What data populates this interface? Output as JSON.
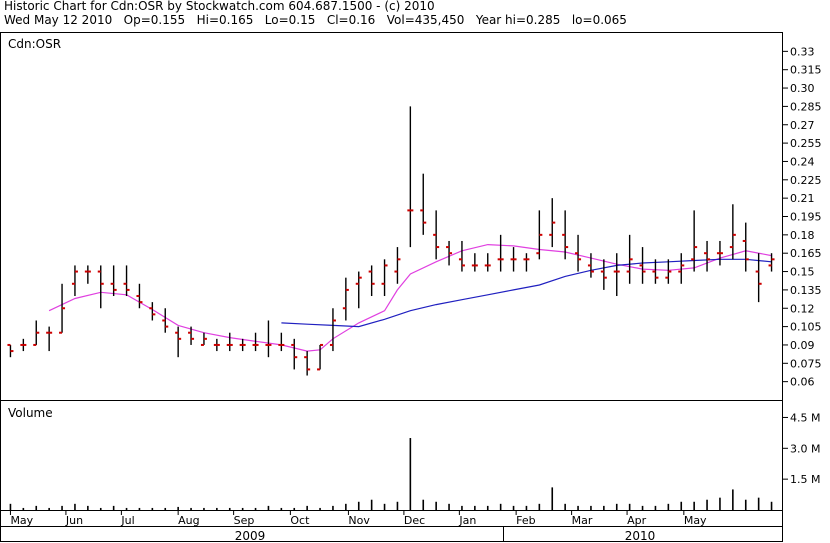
{
  "header": {
    "line1": "Historic Chart for Cdn:OSR by Stockwatch.com 604.687.1500 - (c) 2010",
    "line2": "Wed May 12 2010   Op=0.155   Hi=0.165   Lo=0.15   Cl=0.16   Vol=435,450   Year hi=0.285   lo=0.065"
  },
  "chart_data": {
    "type": "bar",
    "title": "Cdn:OSR",
    "price_panel": {
      "ylim": [
        0.045,
        0.345
      ],
      "yticks": [
        "0.33",
        "0.315",
        "0.30",
        "0.285",
        "0.27",
        "0.255",
        "0.24",
        "0.225",
        "0.21",
        "0.195",
        "0.18",
        "0.165",
        "0.15",
        "0.135",
        "0.12",
        "0.105",
        "0.09",
        "0.075",
        "0.06"
      ],
      "ohlc_weekly": [
        {
          "w": 0,
          "o": 0.09,
          "h": 0.09,
          "l": 0.08,
          "c": 0.085
        },
        {
          "w": 1,
          "o": 0.09,
          "h": 0.095,
          "l": 0.085,
          "c": 0.09
        },
        {
          "w": 2,
          "o": 0.09,
          "h": 0.11,
          "l": 0.09,
          "c": 0.1
        },
        {
          "w": 3,
          "o": 0.1,
          "h": 0.105,
          "l": 0.085,
          "c": 0.1
        },
        {
          "w": 4,
          "o": 0.1,
          "h": 0.14,
          "l": 0.1,
          "c": 0.12
        },
        {
          "w": 5,
          "o": 0.14,
          "h": 0.155,
          "l": 0.13,
          "c": 0.15
        },
        {
          "w": 6,
          "o": 0.15,
          "h": 0.155,
          "l": 0.14,
          "c": 0.15
        },
        {
          "w": 7,
          "o": 0.15,
          "h": 0.155,
          "l": 0.12,
          "c": 0.14
        },
        {
          "w": 8,
          "o": 0.14,
          "h": 0.155,
          "l": 0.13,
          "c": 0.135
        },
        {
          "w": 9,
          "o": 0.14,
          "h": 0.155,
          "l": 0.13,
          "c": 0.135
        },
        {
          "w": 10,
          "o": 0.13,
          "h": 0.14,
          "l": 0.12,
          "c": 0.125
        },
        {
          "w": 11,
          "o": 0.12,
          "h": 0.125,
          "l": 0.11,
          "c": 0.115
        },
        {
          "w": 12,
          "o": 0.11,
          "h": 0.12,
          "l": 0.1,
          "c": 0.105
        },
        {
          "w": 13,
          "o": 0.1,
          "h": 0.105,
          "l": 0.08,
          "c": 0.095
        },
        {
          "w": 14,
          "o": 0.1,
          "h": 0.105,
          "l": 0.09,
          "c": 0.095
        },
        {
          "w": 15,
          "o": 0.09,
          "h": 0.1,
          "l": 0.09,
          "c": 0.095
        },
        {
          "w": 16,
          "o": 0.09,
          "h": 0.095,
          "l": 0.085,
          "c": 0.09
        },
        {
          "w": 17,
          "o": 0.09,
          "h": 0.1,
          "l": 0.085,
          "c": 0.09
        },
        {
          "w": 18,
          "o": 0.09,
          "h": 0.095,
          "l": 0.085,
          "c": 0.09
        },
        {
          "w": 19,
          "o": 0.09,
          "h": 0.1,
          "l": 0.085,
          "c": 0.09
        },
        {
          "w": 20,
          "o": 0.09,
          "h": 0.11,
          "l": 0.08,
          "c": 0.09
        },
        {
          "w": 21,
          "o": 0.09,
          "h": 0.1,
          "l": 0.085,
          "c": 0.09
        },
        {
          "w": 22,
          "o": 0.09,
          "h": 0.095,
          "l": 0.07,
          "c": 0.08
        },
        {
          "w": 23,
          "o": 0.08,
          "h": 0.085,
          "l": 0.065,
          "c": 0.07
        },
        {
          "w": 24,
          "o": 0.07,
          "h": 0.09,
          "l": 0.07,
          "c": 0.09
        },
        {
          "w": 25,
          "o": 0.09,
          "h": 0.12,
          "l": 0.085,
          "c": 0.11
        },
        {
          "w": 26,
          "o": 0.12,
          "h": 0.145,
          "l": 0.11,
          "c": 0.135
        },
        {
          "w": 27,
          "o": 0.14,
          "h": 0.15,
          "l": 0.12,
          "c": 0.145
        },
        {
          "w": 28,
          "o": 0.15,
          "h": 0.155,
          "l": 0.13,
          "c": 0.14
        },
        {
          "w": 29,
          "o": 0.14,
          "h": 0.16,
          "l": 0.13,
          "c": 0.155
        },
        {
          "w": 30,
          "o": 0.15,
          "h": 0.17,
          "l": 0.14,
          "c": 0.16
        },
        {
          "w": 31,
          "o": 0.2,
          "h": 0.285,
          "l": 0.17,
          "c": 0.2
        },
        {
          "w": 32,
          "o": 0.2,
          "h": 0.23,
          "l": 0.18,
          "c": 0.19
        },
        {
          "w": 33,
          "o": 0.18,
          "h": 0.2,
          "l": 0.16,
          "c": 0.17
        },
        {
          "w": 34,
          "o": 0.17,
          "h": 0.175,
          "l": 0.155,
          "c": 0.165
        },
        {
          "w": 35,
          "o": 0.16,
          "h": 0.175,
          "l": 0.15,
          "c": 0.155
        },
        {
          "w": 36,
          "o": 0.155,
          "h": 0.165,
          "l": 0.15,
          "c": 0.155
        },
        {
          "w": 37,
          "o": 0.155,
          "h": 0.165,
          "l": 0.15,
          "c": 0.155
        },
        {
          "w": 38,
          "o": 0.16,
          "h": 0.18,
          "l": 0.15,
          "c": 0.16
        },
        {
          "w": 39,
          "o": 0.16,
          "h": 0.17,
          "l": 0.15,
          "c": 0.16
        },
        {
          "w": 40,
          "o": 0.16,
          "h": 0.165,
          "l": 0.15,
          "c": 0.16
        },
        {
          "w": 41,
          "o": 0.165,
          "h": 0.2,
          "l": 0.16,
          "c": 0.18
        },
        {
          "w": 42,
          "o": 0.18,
          "h": 0.21,
          "l": 0.17,
          "c": 0.19
        },
        {
          "w": 43,
          "o": 0.18,
          "h": 0.2,
          "l": 0.16,
          "c": 0.17
        },
        {
          "w": 44,
          "o": 0.165,
          "h": 0.18,
          "l": 0.15,
          "c": 0.16
        },
        {
          "w": 45,
          "o": 0.155,
          "h": 0.165,
          "l": 0.145,
          "c": 0.15
        },
        {
          "w": 46,
          "o": 0.15,
          "h": 0.16,
          "l": 0.135,
          "c": 0.145
        },
        {
          "w": 47,
          "o": 0.15,
          "h": 0.165,
          "l": 0.13,
          "c": 0.15
        },
        {
          "w": 48,
          "o": 0.15,
          "h": 0.18,
          "l": 0.14,
          "c": 0.16
        },
        {
          "w": 49,
          "o": 0.155,
          "h": 0.17,
          "l": 0.14,
          "c": 0.15
        },
        {
          "w": 50,
          "o": 0.15,
          "h": 0.16,
          "l": 0.14,
          "c": 0.145
        },
        {
          "w": 51,
          "o": 0.145,
          "h": 0.16,
          "l": 0.14,
          "c": 0.15
        },
        {
          "w": 52,
          "o": 0.15,
          "h": 0.165,
          "l": 0.14,
          "c": 0.155
        },
        {
          "w": 53,
          "o": 0.16,
          "h": 0.2,
          "l": 0.15,
          "c": 0.17
        },
        {
          "w": 54,
          "o": 0.165,
          "h": 0.175,
          "l": 0.15,
          "c": 0.16
        },
        {
          "w": 55,
          "o": 0.165,
          "h": 0.175,
          "l": 0.155,
          "c": 0.165
        },
        {
          "w": 56,
          "o": 0.17,
          "h": 0.205,
          "l": 0.16,
          "c": 0.18
        },
        {
          "w": 57,
          "o": 0.175,
          "h": 0.19,
          "l": 0.15,
          "c": 0.16
        },
        {
          "w": 58,
          "o": 0.15,
          "h": 0.165,
          "l": 0.125,
          "c": 0.14
        },
        {
          "w": 59,
          "o": 0.155,
          "h": 0.165,
          "l": 0.15,
          "c": 0.16
        }
      ],
      "ma_pink": [
        [
          3,
          0.118
        ],
        [
          5,
          0.128
        ],
        [
          7,
          0.133
        ],
        [
          9,
          0.131
        ],
        [
          11,
          0.119
        ],
        [
          13,
          0.106
        ],
        [
          15,
          0.1
        ],
        [
          17,
          0.096
        ],
        [
          19,
          0.093
        ],
        [
          21,
          0.09
        ],
        [
          23,
          0.085
        ],
        [
          24,
          0.086
        ],
        [
          25,
          0.095
        ],
        [
          27,
          0.108
        ],
        [
          29,
          0.118
        ],
        [
          30,
          0.135
        ],
        [
          31,
          0.148
        ],
        [
          33,
          0.158
        ],
        [
          35,
          0.167
        ],
        [
          37,
          0.172
        ],
        [
          39,
          0.171
        ],
        [
          41,
          0.168
        ],
        [
          43,
          0.166
        ],
        [
          45,
          0.161
        ],
        [
          47,
          0.156
        ],
        [
          49,
          0.152
        ],
        [
          51,
          0.151
        ],
        [
          53,
          0.153
        ],
        [
          55,
          0.161
        ],
        [
          57,
          0.167
        ],
        [
          59,
          0.163
        ]
      ],
      "ma_blue": [
        [
          21,
          0.108
        ],
        [
          23,
          0.107
        ],
        [
          25,
          0.106
        ],
        [
          27,
          0.105
        ],
        [
          29,
          0.111
        ],
        [
          31,
          0.118
        ],
        [
          33,
          0.123
        ],
        [
          35,
          0.127
        ],
        [
          37,
          0.131
        ],
        [
          39,
          0.135
        ],
        [
          41,
          0.139
        ],
        [
          43,
          0.146
        ],
        [
          45,
          0.151
        ],
        [
          47,
          0.155
        ],
        [
          49,
          0.157
        ],
        [
          51,
          0.158
        ],
        [
          53,
          0.159
        ],
        [
          55,
          0.16
        ],
        [
          57,
          0.16
        ],
        [
          59,
          0.158
        ]
      ]
    },
    "volume_panel": {
      "label": "Volume",
      "ylim": [
        0,
        5.3
      ],
      "yticks": [
        "4.5 M",
        "3.0 M",
        "1.5 M"
      ],
      "tick_values": [
        4.5,
        3.0,
        1.5
      ],
      "weekly_millions": [
        0.3,
        0.1,
        0.2,
        0.1,
        0.2,
        0.3,
        0.2,
        0.1,
        0.2,
        0.1,
        0.1,
        0.1,
        0.1,
        0.15,
        0.1,
        0.1,
        0.1,
        0.1,
        0.1,
        0.1,
        0.2,
        0.1,
        0.1,
        0.2,
        0.1,
        0.2,
        0.3,
        0.4,
        0.5,
        0.3,
        0.4,
        3.5,
        0.5,
        0.4,
        0.3,
        0.2,
        0.2,
        0.2,
        0.3,
        0.2,
        0.2,
        0.3,
        1.1,
        0.3,
        0.2,
        0.2,
        0.2,
        0.3,
        0.3,
        0.2,
        0.2,
        0.3,
        0.4,
        0.4,
        0.5,
        0.6,
        1.0,
        0.5,
        0.6,
        0.4
      ]
    },
    "x_months": [
      "May",
      "Jun",
      "Jul",
      "Aug",
      "Sep",
      "Oct",
      "Nov",
      "Dec",
      "Jan",
      "Feb",
      "Mar",
      "Apr",
      "May"
    ],
    "x_month_weeks": [
      0,
      4.3,
      8.6,
      13,
      17.3,
      21.7,
      26.2,
      30.5,
      34.8,
      39.2,
      43.5,
      47.8,
      52.2
    ],
    "x_years": [
      "2009",
      "2010"
    ],
    "colors": {
      "bar": "#000000",
      "close_tick": "#cc0000",
      "ma_pink": "#e040e0",
      "ma_blue": "#2020c0",
      "border": "#000000"
    }
  }
}
